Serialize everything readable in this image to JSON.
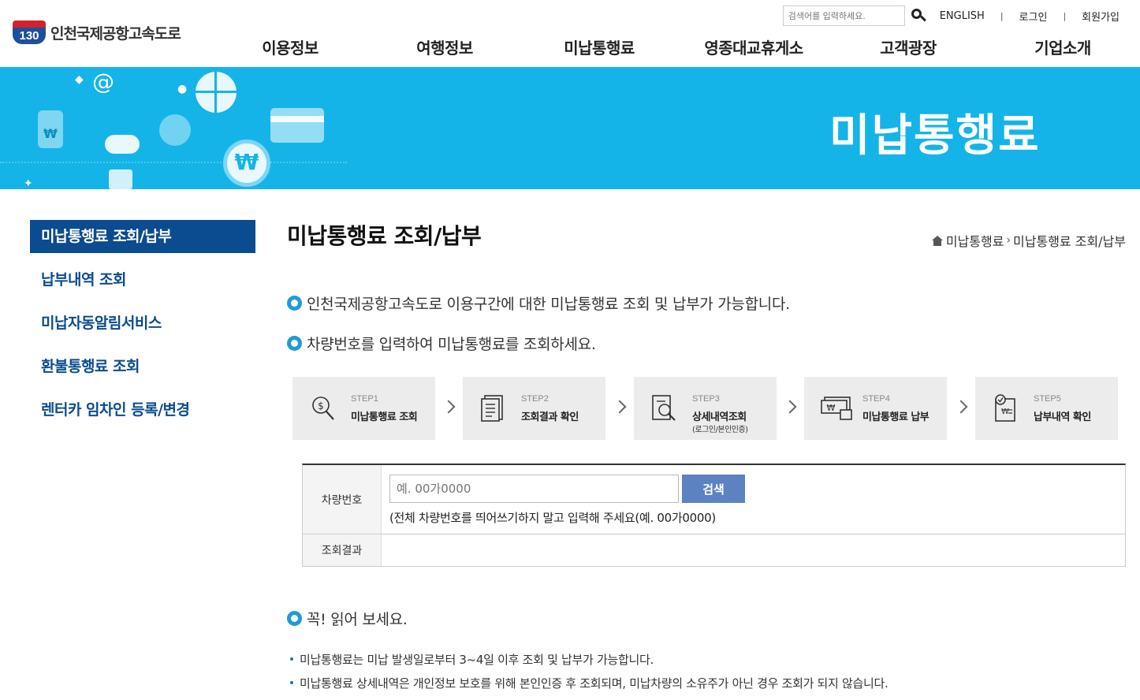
{
  "header": {
    "logo_number": "130",
    "logo_text": "인천국제공항고속도로",
    "search_placeholder": "검색어를 입력하세요.",
    "links": [
      "ENGLISH",
      "로그인",
      "회원가입"
    ],
    "menu": [
      "이용정보",
      "여행정보",
      "미납통행료",
      "영종대교휴게소",
      "고객광장",
      "기업소개"
    ]
  },
  "banner": {
    "title": "미납통행료",
    "coin_symbol": "₩"
  },
  "sidebar": {
    "items": [
      {
        "label": "미납통행료 조회/납부",
        "active": true
      },
      {
        "label": "납부내역 조회"
      },
      {
        "label": "미납자동알림서비스"
      },
      {
        "label": "환불통행료 조회"
      },
      {
        "label": "렌터카 임차인 등록/변경"
      }
    ]
  },
  "main": {
    "title": "미납통행료 조회/납부",
    "breadcrumb": [
      "미납통행료",
      "미납통행료 조회/납부"
    ],
    "intro": [
      "인천국제공항고속도로 이용구간에 대한 미납통행료 조회 및 납부가 가능합니다.",
      "차량번호를 입력하여 미납통행료를 조회하세요."
    ],
    "steps": [
      {
        "num": "STEP1",
        "name": "미납통행료 조회",
        "sub": ""
      },
      {
        "num": "STEP2",
        "name": "조회결과 확인",
        "sub": ""
      },
      {
        "num": "STEP3",
        "name": "상세내역조회",
        "sub": "(로그인/본인인증)"
      },
      {
        "num": "STEP4",
        "name": "미납통행료 납부",
        "sub": ""
      },
      {
        "num": "STEP5",
        "name": "납부내역 확인",
        "sub": ""
      }
    ],
    "form": {
      "car_label": "차량번호",
      "car_placeholder": "예. 00가0000",
      "search_label": "검색",
      "hint": "(전체 차량번호를 띄어쓰기하지 말고 입력해 주세요(예. 00가0000)",
      "result_label": "조회결과"
    },
    "notice_title": "꼭! 읽어 보세요.",
    "notes": [
      "미납통행료는 미납 발생일로부터 3~4일 이후 조회 및 납부가 가능합니다.",
      "미납통행료 상세내역은 개인정보 보호를 위해 본인인증 후 조회되며, 미납차량의 소유주가 아닌 경우 조회가 되지 않습니다."
    ]
  },
  "colors": {
    "accent": "#0b4b8f",
    "banner": "#14b4e8",
    "bullet": "#1e9bd7",
    "button": "#5c82c2"
  }
}
